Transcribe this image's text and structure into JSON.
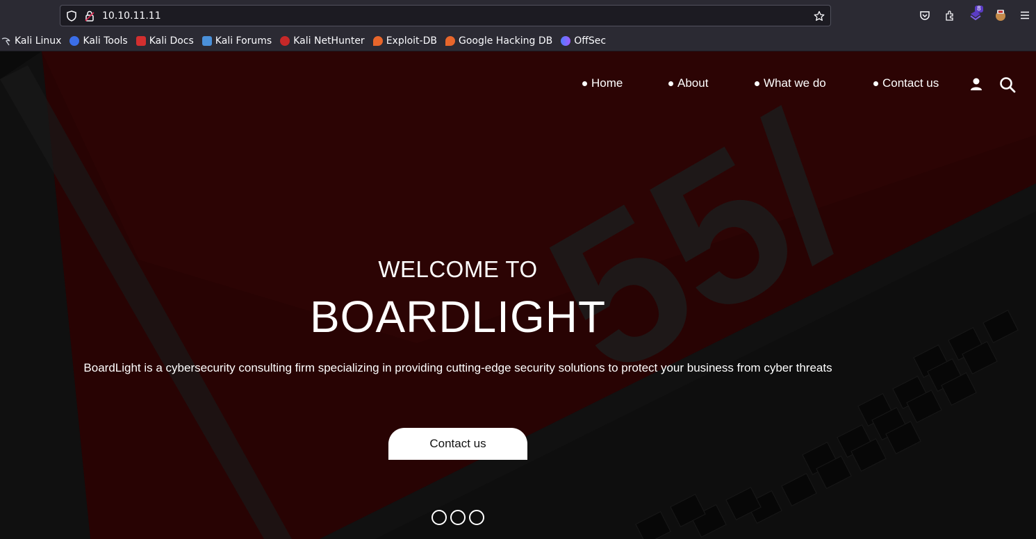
{
  "browser": {
    "url": "10.10.11.11",
    "extension_badge": "8",
    "bookmarks": [
      {
        "label": "Kali Linux",
        "color": "#3b82f6"
      },
      {
        "label": "Kali Tools",
        "color": "#3b6ee8"
      },
      {
        "label": "Kali Docs",
        "color": "#d32f2f"
      },
      {
        "label": "Kali Forums",
        "color": "#4a90d9"
      },
      {
        "label": "Kali NetHunter",
        "color": "#c62828"
      },
      {
        "label": "Exploit-DB",
        "color": "#e8662b"
      },
      {
        "label": "Google Hacking DB",
        "color": "#e8662b"
      },
      {
        "label": "OffSec",
        "color": "#6b7cff"
      }
    ]
  },
  "site": {
    "nav": [
      {
        "label": "Home"
      },
      {
        "label": "About"
      },
      {
        "label": "What we do"
      },
      {
        "label": "Contact us"
      }
    ],
    "hero": {
      "subtitle": "WELCOME TO",
      "title": "BOARDLIGHT",
      "description": "BoardLight is a cybersecurity consulting firm specializing in providing cutting-edge security solutions to protect your business from cyber threats",
      "cta_label": "Contact us"
    },
    "colors": {
      "accent_red": "#5a0a0a",
      "button_bg": "#ffffff"
    }
  }
}
